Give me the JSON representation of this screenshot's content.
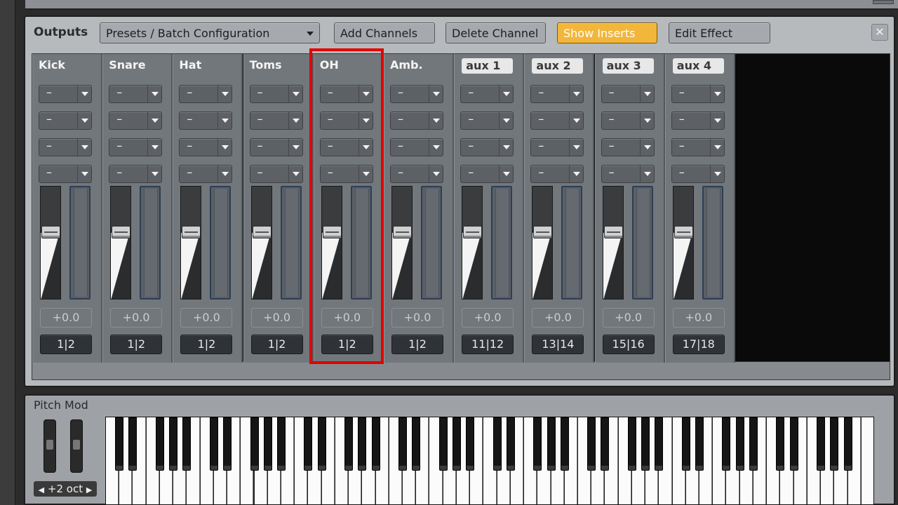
{
  "toolbar": {
    "title": "Outputs",
    "preset_label": "Presets / Batch Configuration",
    "add_label": "Add Channels",
    "delete_label": "Delete Channel",
    "show_inserts_label": "Show Inserts",
    "edit_effect_label": "Edit Effect",
    "close_label": "✕"
  },
  "mixer": {
    "channels": [
      {
        "name": "Kick",
        "aux": false,
        "gain": "+0.0",
        "route": "1|2",
        "fader_level": 0.6
      },
      {
        "name": "Snare",
        "aux": false,
        "gain": "+0.0",
        "route": "1|2",
        "fader_level": 0.6
      },
      {
        "name": "Hat",
        "aux": false,
        "gain": "+0.0",
        "route": "1|2",
        "fader_level": 0.6
      },
      {
        "name": "Toms",
        "aux": false,
        "gain": "+0.0",
        "route": "1|2",
        "fader_level": 0.6
      },
      {
        "name": "OH",
        "aux": false,
        "gain": "+0.0",
        "route": "1|2",
        "fader_level": 0.6
      },
      {
        "name": "Amb.",
        "aux": false,
        "gain": "+0.0",
        "route": "1|2",
        "fader_level": 0.6
      },
      {
        "name": "aux 1",
        "aux": true,
        "gain": "+0.0",
        "route": "11|12",
        "fader_level": 0.6
      },
      {
        "name": "aux 2",
        "aux": true,
        "gain": "+0.0",
        "route": "13|14",
        "fader_level": 0.6
      },
      {
        "name": "aux 3",
        "aux": true,
        "gain": "+0.0",
        "route": "15|16",
        "fader_level": 0.6
      },
      {
        "name": "aux 4",
        "aux": true,
        "gain": "+0.0",
        "route": "17|18",
        "fader_level": 0.6
      }
    ],
    "insert_slot_value": "–",
    "highlighted_channel": "OH",
    "highlight_color": "#e40000",
    "active_button_color": "#f2b63a"
  },
  "keyboard": {
    "label": "Pitch Mod",
    "octave_left_icon": "◀",
    "octave_right_icon": "▶",
    "octave_label": "+2 oct",
    "white_key_count": 57
  }
}
